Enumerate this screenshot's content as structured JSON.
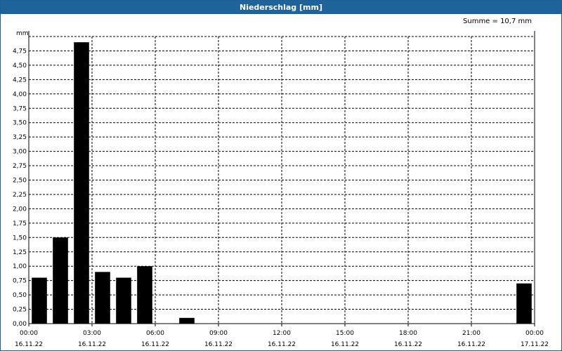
{
  "window": {
    "title": "Niederschlag [mm]"
  },
  "summary": {
    "text": "Summe = 10,7 mm"
  },
  "colors": {
    "titlebar": "#1f639b",
    "bar": "#000000",
    "grid": "#000000"
  },
  "chart_data": {
    "type": "bar",
    "title": "Niederschlag [mm]",
    "ylabel": "mm",
    "xlabel": "",
    "ylim": [
      0,
      5.0
    ],
    "ytick_step": 0.25,
    "ytick_labels": [
      "0,00",
      "0,25",
      "0,50",
      "0,75",
      "1,00",
      "1,25",
      "1,50",
      "1,75",
      "2,00",
      "2,25",
      "2,50",
      "2,75",
      "3,00",
      "3,25",
      "3,50",
      "3,75",
      "4,00",
      "4,25",
      "4,50",
      "4,75"
    ],
    "x_hours_range": [
      0,
      24
    ],
    "xtick_labels": [
      {
        "time": "00:00",
        "date": "16.11.22"
      },
      {
        "time": "03:00",
        "date": "16.11.22"
      },
      {
        "time": "06:00",
        "date": "16.11.22"
      },
      {
        "time": "09:00",
        "date": "16.11.22"
      },
      {
        "time": "12:00",
        "date": "16.11.22"
      },
      {
        "time": "15:00",
        "date": "16.11.22"
      },
      {
        "time": "18:00",
        "date": "16.11.22"
      },
      {
        "time": "21:00",
        "date": "16.11.22"
      },
      {
        "time": "00:00",
        "date": "17.11.22"
      }
    ],
    "bars": [
      {
        "hour": 0,
        "value": 0.8
      },
      {
        "hour": 1,
        "value": 1.5
      },
      {
        "hour": 2,
        "value": 4.9
      },
      {
        "hour": 3,
        "value": 0.9
      },
      {
        "hour": 4,
        "value": 0.8
      },
      {
        "hour": 5,
        "value": 1.0
      },
      {
        "hour": 7,
        "value": 0.1
      },
      {
        "hour": 23,
        "value": 0.7
      }
    ],
    "grid": true
  }
}
